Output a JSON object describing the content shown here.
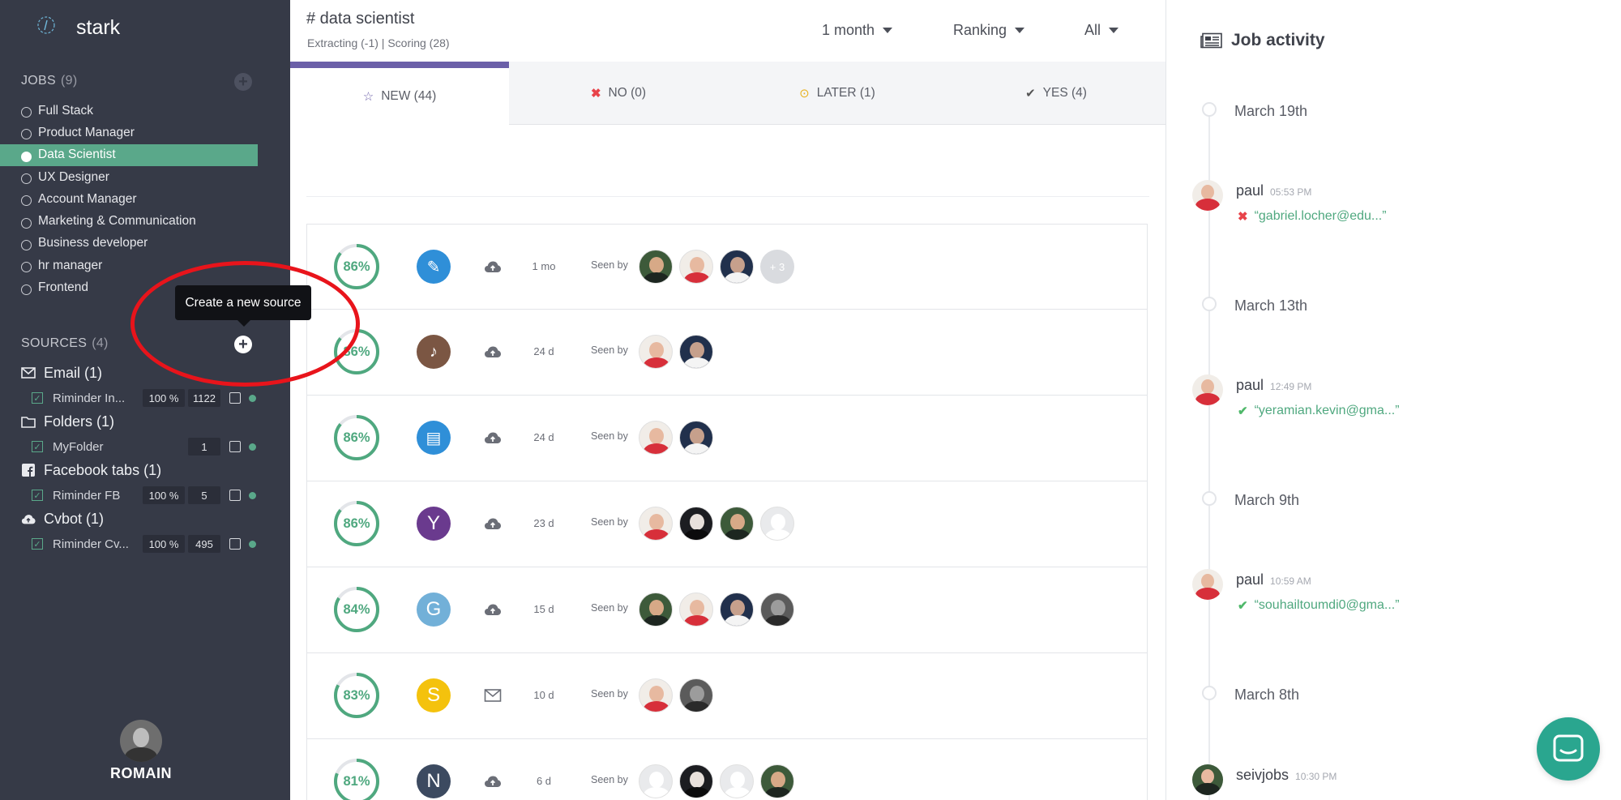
{
  "sidebar": {
    "brand": "stark",
    "jobs_heading": "JOBS",
    "jobs_count": "(9)",
    "jobs": [
      {
        "label": "Full Stack"
      },
      {
        "label": "Product Manager"
      },
      {
        "label": "Data Scientist"
      },
      {
        "label": "UX Designer"
      },
      {
        "label": "Account Manager"
      },
      {
        "label": "Marketing & Communication"
      },
      {
        "label": "Business developer"
      },
      {
        "label": "hr manager"
      },
      {
        "label": "Frontend"
      }
    ],
    "active_job": "Data Scientist",
    "sources_heading": "SOURCES",
    "sources_count": "(4)",
    "tooltip": "Create a new source",
    "sources": [
      {
        "title": "Email (1)",
        "icon": "envelope-icon",
        "item": "Riminder In...",
        "pct": "100 %",
        "count": "1122"
      },
      {
        "title": "Folders (1)",
        "icon": "folder-icon",
        "item": "MyFolder",
        "pct": "",
        "count": "1"
      },
      {
        "title": "Facebook tabs (1)",
        "icon": "facebook-icon",
        "item": "Riminder FB",
        "pct": "100 %",
        "count": "5"
      },
      {
        "title": "Cvbot (1)",
        "icon": "cloud-upload-icon",
        "item": "Riminder Cv...",
        "pct": "100 %",
        "count": "495"
      }
    ],
    "user": "ROMAIN"
  },
  "header": {
    "title": "# data scientist",
    "subtitle": "Extracting (-1)  |  Scoring (28)",
    "filters": [
      {
        "label": "1 month"
      },
      {
        "label": "Ranking"
      },
      {
        "label": "All"
      }
    ]
  },
  "tabs": [
    {
      "label": "NEW (44)",
      "icon": "star-icon"
    },
    {
      "label": "NO (0)",
      "icon": "cross-icon"
    },
    {
      "label": "LATER (1)",
      "icon": "clock-icon"
    },
    {
      "label": "YES (4)",
      "icon": "check-icon"
    }
  ],
  "candidates": [
    {
      "score": "86%",
      "score_value": 0.86,
      "logo": "",
      "logo_color": "#2f8fd8",
      "source": "cloud-upload-icon",
      "age": "1 mo",
      "seen_label": "Seen by",
      "seen_more": "+ 3"
    },
    {
      "score": "86%",
      "score_value": 0.86,
      "logo": "",
      "logo_color": "#7b5643",
      "source": "cloud-upload-icon",
      "age": "24 d",
      "seen_label": "Seen by"
    },
    {
      "score": "86%",
      "score_value": 0.86,
      "logo": "",
      "logo_color": "#2f8fd8",
      "source": "cloud-upload-icon",
      "age": "24 d",
      "seen_label": "Seen by"
    },
    {
      "score": "86%",
      "score_value": 0.86,
      "logo": "Y",
      "logo_color": "#6a3a8e",
      "source": "cloud-upload-icon",
      "age": "23 d",
      "seen_label": "Seen by"
    },
    {
      "score": "84%",
      "score_value": 0.84,
      "logo": "G",
      "logo_color": "#72b0d8",
      "source": "cloud-upload-icon",
      "age": "15 d",
      "seen_label": "Seen by"
    },
    {
      "score": "83%",
      "score_value": 0.83,
      "logo": "S",
      "logo_color": "#f4c20d",
      "source": "envelope-icon",
      "age": "10 d",
      "seen_label": "Seen by"
    },
    {
      "score": "81%",
      "score_value": 0.81,
      "logo": "N",
      "logo_color": "#3c4a60",
      "source": "cloud-upload-icon",
      "age": "6 d",
      "seen_label": "Seen by"
    }
  ],
  "activity": {
    "title": "Job activity",
    "dates": [
      "March 19th",
      "March 13th",
      "March 9th",
      "March 8th"
    ],
    "entries": [
      {
        "user": "paul",
        "time": "05:53 PM",
        "status": "no",
        "text": "“gabriel.locher@edu...”"
      },
      {
        "user": "paul",
        "time": "12:49 PM",
        "status": "yes",
        "text": "“yeramian.kevin@gma...”"
      },
      {
        "user": "paul",
        "time": "10:59 AM",
        "status": "yes",
        "text": "“souhailtoumdi0@gma...”"
      },
      {
        "user": "seivjobs",
        "time": "10:30 PM",
        "status": "",
        "text": ""
      }
    ]
  },
  "colors": {
    "sidebar": "#363a47",
    "accent": "#5aa88a",
    "tab_indicator": "#6b5fa8",
    "score": "#4fa87f",
    "chat": "#2aa68f"
  }
}
